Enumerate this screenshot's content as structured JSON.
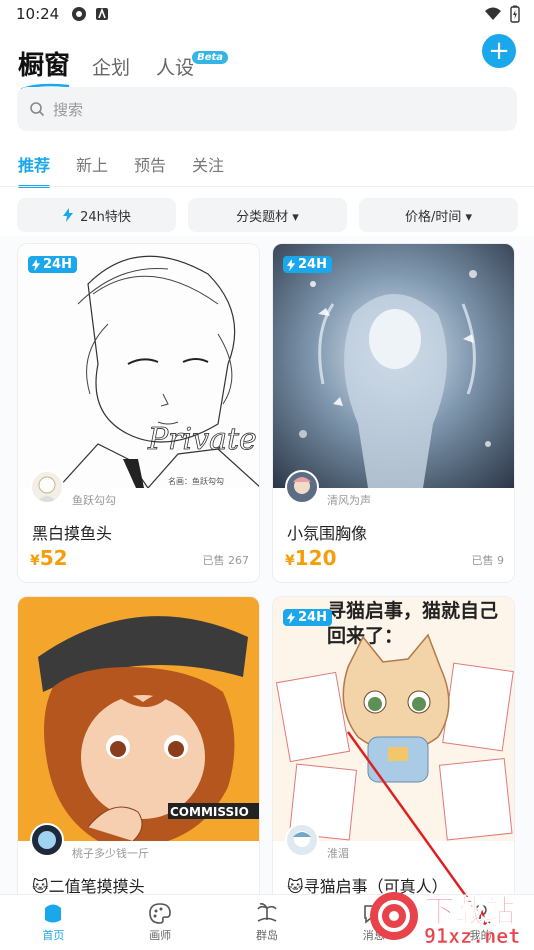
{
  "status_bar": {
    "time": "10:24"
  },
  "header": {
    "tabs": [
      {
        "label": "橱窗"
      },
      {
        "label": "企划"
      },
      {
        "label": "人设"
      }
    ],
    "beta_label": "Beta",
    "add_label": "+"
  },
  "search": {
    "placeholder": "搜索"
  },
  "filter_tabs": [
    {
      "label": "推荐"
    },
    {
      "label": "新上"
    },
    {
      "label": "预告"
    },
    {
      "label": "关注"
    }
  ],
  "chips": [
    {
      "label": "24h特快"
    },
    {
      "label": "分类题材 ▾"
    },
    {
      "label": "价格/时间 ▾"
    }
  ],
  "cards": [
    {
      "badge": "24H",
      "artist": "鱼跃勾勾",
      "title": "黑白摸鱼头",
      "currency": "¥",
      "price": "52",
      "sold": "已售 267",
      "image_text": "Private",
      "caption": "名画：鱼跃勾勾"
    },
    {
      "badge": "24H",
      "artist": "清风为声",
      "title": "小氛围胸像",
      "currency": "¥",
      "price": "120",
      "sold": "已售 9"
    },
    {
      "artist": "桃子多少钱一斤",
      "title": "🐱二值笔摸摸头",
      "image_text": "COMMISSIO"
    },
    {
      "badge": "24H",
      "artist": "淮湄",
      "title": "🐱寻猫启事（可真人）",
      "image_text": "寻猫启事，猫就自己回来了："
    }
  ],
  "bottom_nav": [
    {
      "label": "首页"
    },
    {
      "label": "画师"
    },
    {
      "label": "群岛"
    },
    {
      "label": "消息"
    },
    {
      "label": "我的"
    }
  ],
  "watermark": {
    "text": "下载站",
    "url": "91xz.net"
  },
  "colors": {
    "accent": "#1aa7ec",
    "price": "#f59e0b",
    "watermark": "#e8434a"
  }
}
